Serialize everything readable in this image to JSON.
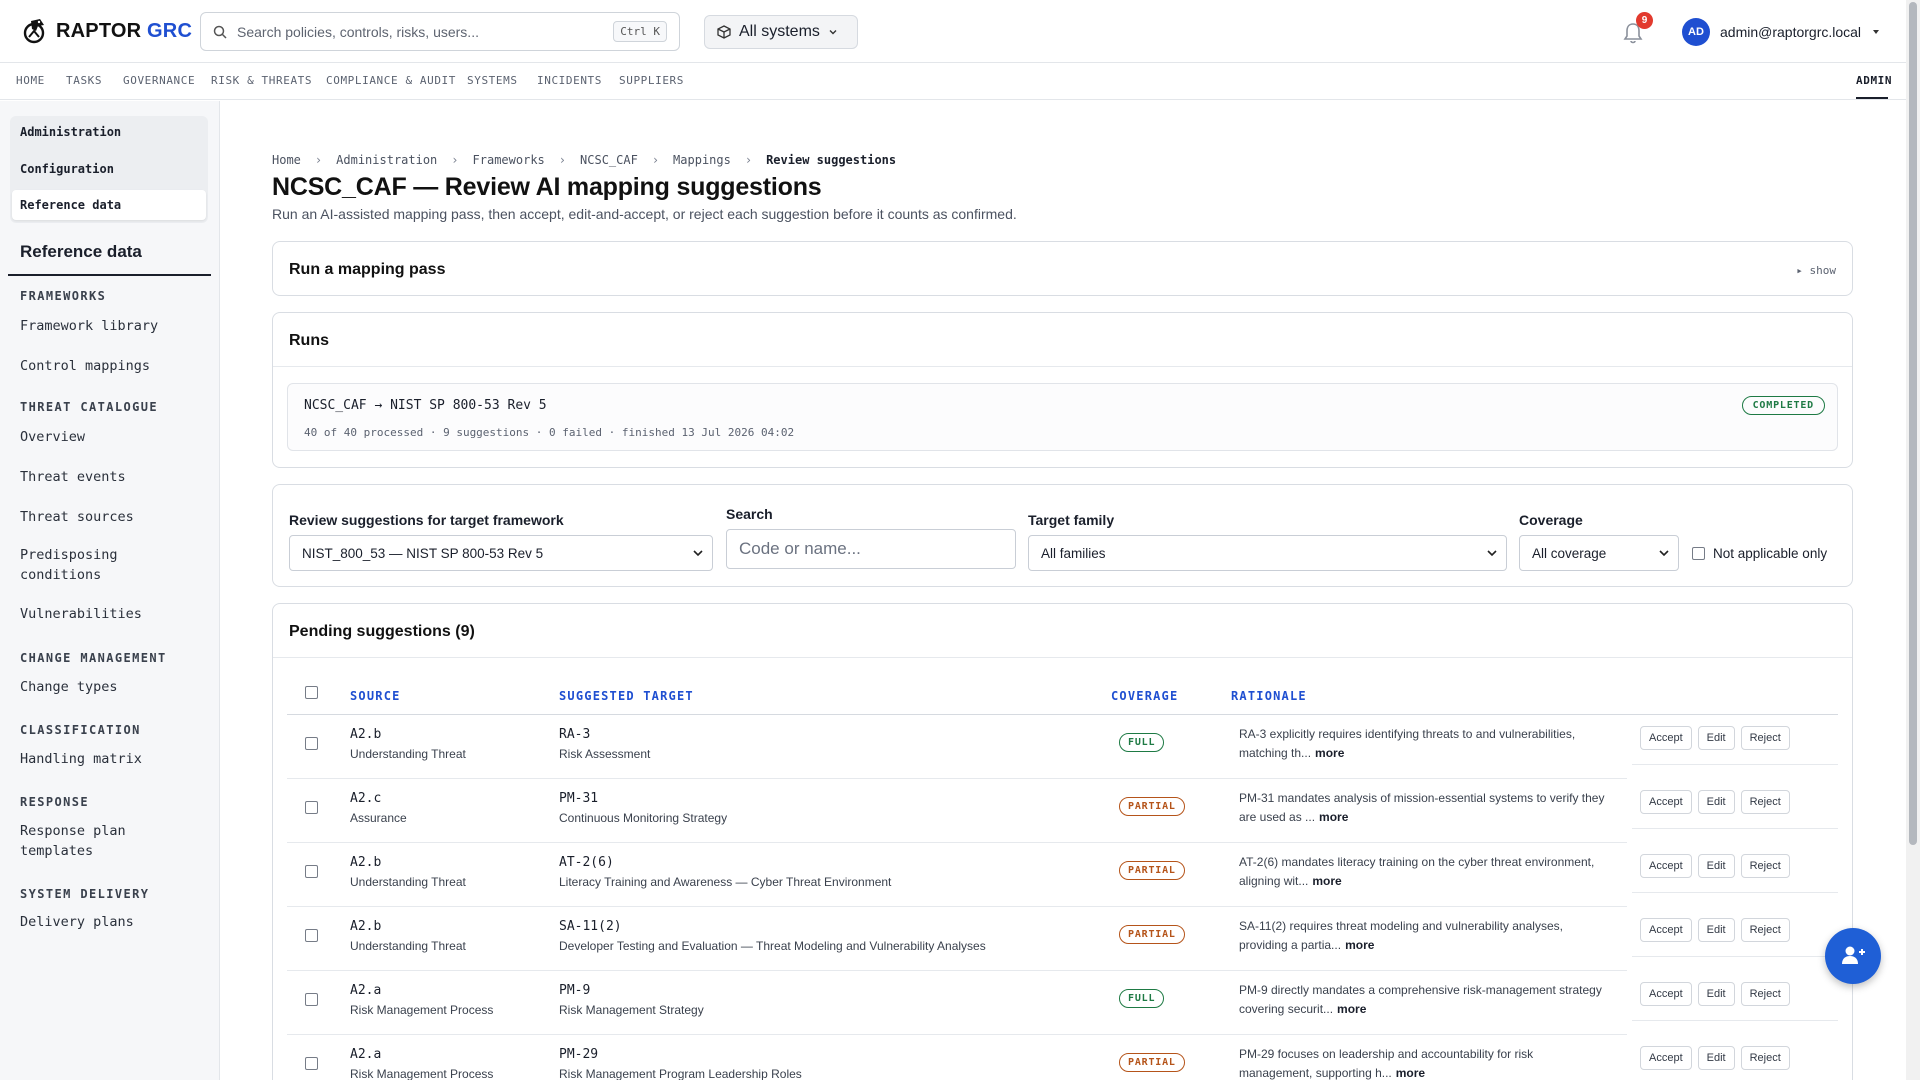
{
  "app": {
    "brand_main": "RAPTOR ",
    "brand_accent": "GRC",
    "accent_color": "#1f4fd1"
  },
  "search": {
    "placeholder": "Search policies, controls, risks, users...",
    "shortcut": "Ctrl K"
  },
  "system_selector": {
    "value": "All systems"
  },
  "notifications": {
    "count": "9"
  },
  "user": {
    "initials": "AD",
    "email": "admin@raptorgrc.local"
  },
  "nav": {
    "items": [
      "HOME",
      "TASKS",
      "GOVERNANCE",
      "RISK & THREATS",
      "COMPLIANCE & AUDIT",
      "SYSTEMS",
      "INCIDENTS",
      "SUPPLIERS"
    ],
    "admin": "ADMIN"
  },
  "sidebar": {
    "top": [
      "Administration",
      "Configuration",
      "Reference data"
    ],
    "title": "Reference data",
    "sections": [
      {
        "heading": "FRAMEWORKS",
        "links": [
          "Framework library",
          "Control mappings"
        ]
      },
      {
        "heading": "THREAT CATALOGUE",
        "links": [
          "Overview",
          "Threat events",
          "Threat sources",
          "Predisposing conditions",
          "Vulnerabilities"
        ]
      },
      {
        "heading": "CHANGE MANAGEMENT",
        "links": [
          "Change types"
        ]
      },
      {
        "heading": "CLASSIFICATION",
        "links": [
          "Handling matrix"
        ]
      },
      {
        "heading": "RESPONSE",
        "links": [
          "Response plan templates"
        ]
      },
      {
        "heading": "SYSTEM DELIVERY",
        "links": [
          "Delivery plans"
        ]
      }
    ]
  },
  "breadcrumb": [
    "Home",
    "Administration",
    "Frameworks",
    "NCSC_CAF",
    "Mappings",
    "Review suggestions"
  ],
  "page": {
    "title": "NCSC_CAF — Review AI mapping suggestions",
    "subtitle": "Run an AI-assisted mapping pass, then accept, edit-and-accept, or reject each suggestion before it counts as confirmed."
  },
  "mapping_pass": {
    "title": "Run a mapping pass",
    "toggle": "▸ show"
  },
  "runs": {
    "title": "Runs",
    "items": [
      {
        "name": "NCSC_CAF → NIST SP 800-53 Rev 5",
        "meta": "40 of 40 processed · 9 suggestions · 0 failed · finished 13 Jul 2026 04:02",
        "status": "COMPLETED"
      }
    ]
  },
  "filters": {
    "target_label": "Review suggestions for target framework",
    "target_value": "NIST_800_53 — NIST SP 800-53 Rev 5",
    "search_label": "Search",
    "search_placeholder": "Code or name...",
    "family_label": "Target family",
    "family_value": "All families",
    "coverage_label": "Coverage",
    "coverage_value": "All coverage",
    "na_label": "Not applicable only"
  },
  "pending": {
    "title": "Pending suggestions (9)",
    "columns": {
      "source": "SOURCE",
      "target": "SUGGESTED TARGET",
      "coverage": "COVERAGE",
      "rationale": "RATIONALE"
    },
    "actions": {
      "accept": "Accept",
      "edit": "Edit",
      "reject": "Reject"
    },
    "more": "more",
    "rows": [
      {
        "src_code": "A2.b",
        "src_name": "Understanding Threat",
        "tgt_code": "RA-3",
        "tgt_name": "Risk Assessment",
        "coverage": "FULL",
        "rationale": "RA-3 explicitly requires identifying threats to and vulnerabilities, matching th..."
      },
      {
        "src_code": "A2.c",
        "src_name": "Assurance",
        "tgt_code": "PM-31",
        "tgt_name": "Continuous Monitoring Strategy",
        "coverage": "PARTIAL",
        "rationale": "PM-31 mandates analysis of mission-essential systems to verify they are used as ..."
      },
      {
        "src_code": "A2.b",
        "src_name": "Understanding Threat",
        "tgt_code": "AT-2(6)",
        "tgt_name": "Literacy Training and Awareness — Cyber Threat Environment",
        "coverage": "PARTIAL",
        "rationale": "AT-2(6) mandates literacy training on the cyber threat environment, aligning wit..."
      },
      {
        "src_code": "A2.b",
        "src_name": "Understanding Threat",
        "tgt_code": "SA-11(2)",
        "tgt_name": "Developer Testing and Evaluation — Threat Modeling and Vulnerability Analyses",
        "coverage": "PARTIAL",
        "rationale": "SA-11(2) requires threat modeling and vulnerability analyses, providing a partia..."
      },
      {
        "src_code": "A2.a",
        "src_name": "Risk Management Process",
        "tgt_code": "PM-9",
        "tgt_name": "Risk Management Strategy",
        "coverage": "FULL",
        "rationale": "PM-9 directly mandates a comprehensive risk-management strategy covering securit..."
      },
      {
        "src_code": "A2.a",
        "src_name": "Risk Management Process",
        "tgt_code": "PM-29",
        "tgt_name": "Risk Management Program Leadership Roles",
        "coverage": "PARTIAL",
        "rationale": "PM-29 focuses on leadership and accountability for risk management, supporting h..."
      }
    ]
  }
}
